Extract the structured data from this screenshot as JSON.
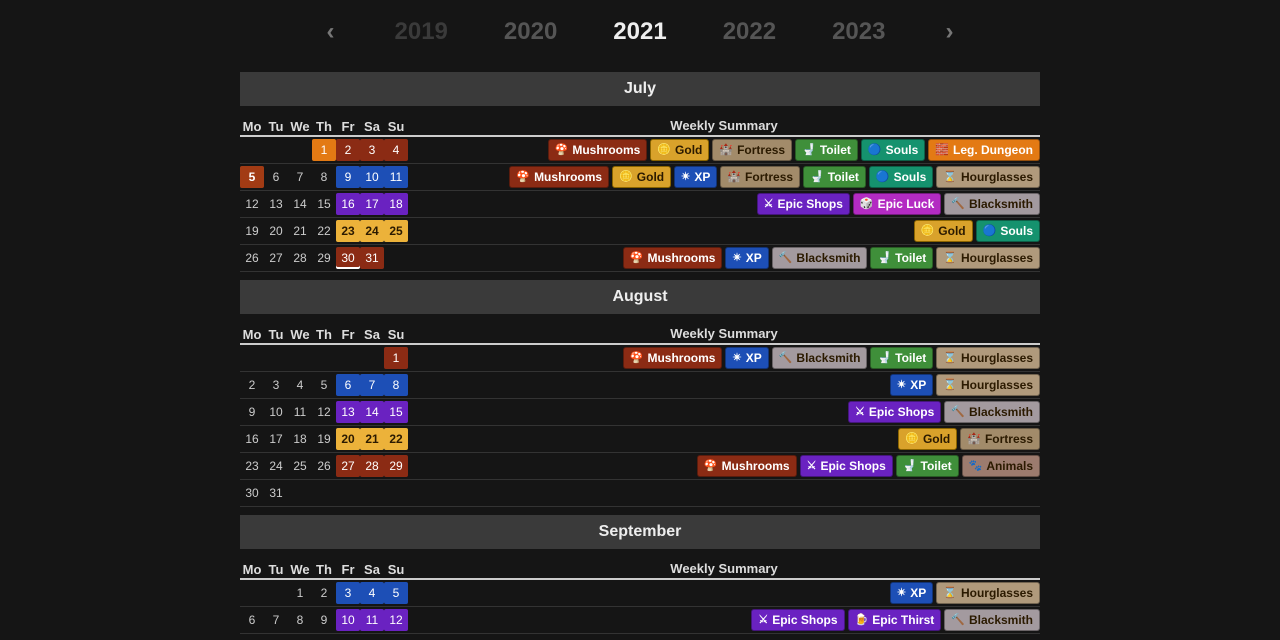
{
  "pager": {
    "prev_icon": "‹",
    "next_icon": "›",
    "years": [
      "2019",
      "2020",
      "2021",
      "2022",
      "2023"
    ],
    "active_idx": 2
  },
  "summary_header": "Weekly Summary",
  "dow": [
    "Mo",
    "Tu",
    "We",
    "Th",
    "Fr",
    "Sa",
    "Su"
  ],
  "tag_types": {
    "mush": {
      "label": "Mushrooms",
      "cls": "c-mush",
      "ico": "🍄"
    },
    "gold": {
      "label": "Gold",
      "cls": "c-gold",
      "ico": "🪙"
    },
    "fortress": {
      "label": "Fortress",
      "cls": "c-fortress",
      "ico": "🏰"
    },
    "toilet": {
      "label": "Toilet",
      "cls": "c-toilet",
      "ico": "🚽"
    },
    "souls": {
      "label": "Souls",
      "cls": "c-souls",
      "ico": "🔵"
    },
    "legdun": {
      "label": "Leg. Dungeon",
      "cls": "c-legdun",
      "ico": "🧱"
    },
    "xp": {
      "label": "XP",
      "cls": "c-xp",
      "ico": "✴"
    },
    "hour": {
      "label": "Hourglasses",
      "cls": "c-hour",
      "ico": "⌛"
    },
    "eshops": {
      "label": "Epic Shops",
      "cls": "c-eshops",
      "ico": "⚔"
    },
    "eluck": {
      "label": "Epic Luck",
      "cls": "c-eluck",
      "ico": "🎲"
    },
    "ethirst": {
      "label": "Epic Thirst",
      "cls": "c-ethirst",
      "ico": "🍺"
    },
    "black": {
      "label": "Blacksmith",
      "cls": "c-black",
      "ico": "🔨"
    },
    "animals": {
      "label": "Animals",
      "cls": "c-animals",
      "ico": "🐾"
    }
  },
  "months": [
    {
      "name": "July",
      "weeks": [
        {
          "days": [
            null,
            null,
            null,
            {
              "d": 1,
              "hl": "h-legdun"
            },
            {
              "d": 2,
              "hl": "h-mush"
            },
            {
              "d": 3,
              "hl": "h-mush"
            },
            {
              "d": 4,
              "hl": "h-mush"
            }
          ],
          "tags": [
            "mush",
            "gold",
            "fortress",
            "toilet",
            "souls",
            "legdun"
          ]
        },
        {
          "days": [
            {
              "d": 5,
              "hl": "today"
            },
            {
              "d": 6
            },
            {
              "d": 7
            },
            {
              "d": 8
            },
            {
              "d": 9,
              "hl": "h-xp"
            },
            {
              "d": 10,
              "hl": "h-xp"
            },
            {
              "d": 11,
              "hl": "h-xp"
            }
          ],
          "tags": [
            "mush",
            "gold",
            "xp",
            "fortress",
            "toilet",
            "souls",
            "hour"
          ]
        },
        {
          "days": [
            {
              "d": 12
            },
            {
              "d": 13
            },
            {
              "d": 14
            },
            {
              "d": 15
            },
            {
              "d": 16,
              "hl": "h-eshops"
            },
            {
              "d": 17,
              "hl": "h-eshops"
            },
            {
              "d": 18,
              "hl": "h-eshops"
            }
          ],
          "tags": [
            "eshops",
            "eluck",
            "black"
          ]
        },
        {
          "days": [
            {
              "d": 19
            },
            {
              "d": 20
            },
            {
              "d": 21
            },
            {
              "d": 22
            },
            {
              "d": 23,
              "hl": "h-gold"
            },
            {
              "d": 24,
              "hl": "h-gold"
            },
            {
              "d": 25,
              "hl": "h-gold"
            }
          ],
          "tags": [
            "gold",
            "souls"
          ]
        },
        {
          "days": [
            {
              "d": 26
            },
            {
              "d": 27
            },
            {
              "d": 28
            },
            {
              "d": 29
            },
            {
              "d": 30,
              "hl": "h-mush ul-today"
            },
            {
              "d": 31,
              "hl": "h-mush"
            },
            null
          ],
          "tags": [
            "mush",
            "xp",
            "black",
            "toilet",
            "hour"
          ]
        }
      ]
    },
    {
      "name": "August",
      "weeks": [
        {
          "days": [
            null,
            null,
            null,
            null,
            null,
            null,
            {
              "d": 1,
              "hl": "h-mush"
            }
          ],
          "tags": [
            "mush",
            "xp",
            "black",
            "toilet",
            "hour"
          ]
        },
        {
          "days": [
            {
              "d": 2
            },
            {
              "d": 3
            },
            {
              "d": 4
            },
            {
              "d": 5
            },
            {
              "d": 6,
              "hl": "h-xp"
            },
            {
              "d": 7,
              "hl": "h-xp"
            },
            {
              "d": 8,
              "hl": "h-xp"
            }
          ],
          "tags": [
            "xp",
            "hour"
          ]
        },
        {
          "days": [
            {
              "d": 9
            },
            {
              "d": 10
            },
            {
              "d": 11
            },
            {
              "d": 12
            },
            {
              "d": 13,
              "hl": "h-eshops"
            },
            {
              "d": 14,
              "hl": "h-eshops"
            },
            {
              "d": 15,
              "hl": "h-eshops"
            }
          ],
          "tags": [
            "eshops",
            "black"
          ]
        },
        {
          "days": [
            {
              "d": 16
            },
            {
              "d": 17
            },
            {
              "d": 18
            },
            {
              "d": 19
            },
            {
              "d": 20,
              "hl": "h-gold"
            },
            {
              "d": 21,
              "hl": "h-gold"
            },
            {
              "d": 22,
              "hl": "h-gold"
            }
          ],
          "tags": [
            "gold",
            "fortress"
          ]
        },
        {
          "days": [
            {
              "d": 23
            },
            {
              "d": 24
            },
            {
              "d": 25
            },
            {
              "d": 26
            },
            {
              "d": 27,
              "hl": "h-mush"
            },
            {
              "d": 28,
              "hl": "h-mush"
            },
            {
              "d": 29,
              "hl": "h-mush"
            }
          ],
          "tags": [
            "mush",
            "eshops",
            "toilet",
            "animals"
          ]
        },
        {
          "days": [
            {
              "d": 30
            },
            {
              "d": 31
            },
            null,
            null,
            null,
            null,
            null
          ],
          "tags": []
        }
      ]
    },
    {
      "name": "September",
      "weeks": [
        {
          "days": [
            null,
            null,
            {
              "d": 1
            },
            {
              "d": 2
            },
            {
              "d": 3,
              "hl": "h-xp"
            },
            {
              "d": 4,
              "hl": "h-xp"
            },
            {
              "d": 5,
              "hl": "h-xp"
            }
          ],
          "tags": [
            "xp",
            "hour"
          ]
        },
        {
          "days": [
            {
              "d": 6
            },
            {
              "d": 7
            },
            {
              "d": 8
            },
            {
              "d": 9
            },
            {
              "d": 10,
              "hl": "h-eshops"
            },
            {
              "d": 11,
              "hl": "h-eshops"
            },
            {
              "d": 12,
              "hl": "h-eshops"
            }
          ],
          "tags": [
            "eshops",
            "ethirst",
            "black"
          ]
        }
      ]
    }
  ]
}
